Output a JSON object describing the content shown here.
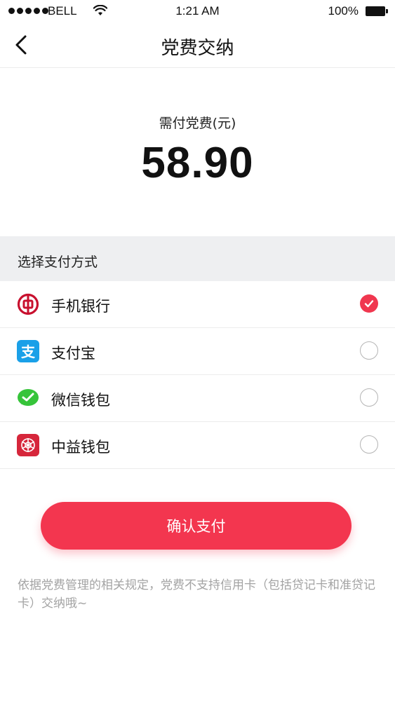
{
  "status_bar": {
    "carrier": "BELL",
    "time": "1:21 AM",
    "battery": "100%"
  },
  "nav": {
    "title": "党费交纳"
  },
  "amount": {
    "label": "需付党费(元)",
    "value": "58.90"
  },
  "payment": {
    "section_title": "选择支付方式",
    "methods": [
      {
        "label": "手机银行",
        "icon": "bank-of-china-icon",
        "selected": true
      },
      {
        "label": "支付宝",
        "icon": "alipay-icon",
        "selected": false
      },
      {
        "label": "微信钱包",
        "icon": "wechat-icon",
        "selected": false
      },
      {
        "label": "中益钱包",
        "icon": "zhongyi-wallet-icon",
        "selected": false
      }
    ]
  },
  "confirm": {
    "label": "确认支付"
  },
  "notice": {
    "text": "依据党费管理的相关规定，党费不支持信用卡（包括贷记卡和准贷记卡）交纳哦~"
  },
  "colors": {
    "accent": "#f3364f",
    "alipay": "#1aa0e8",
    "wechat": "#36c43a",
    "bank": "#c8102e"
  }
}
